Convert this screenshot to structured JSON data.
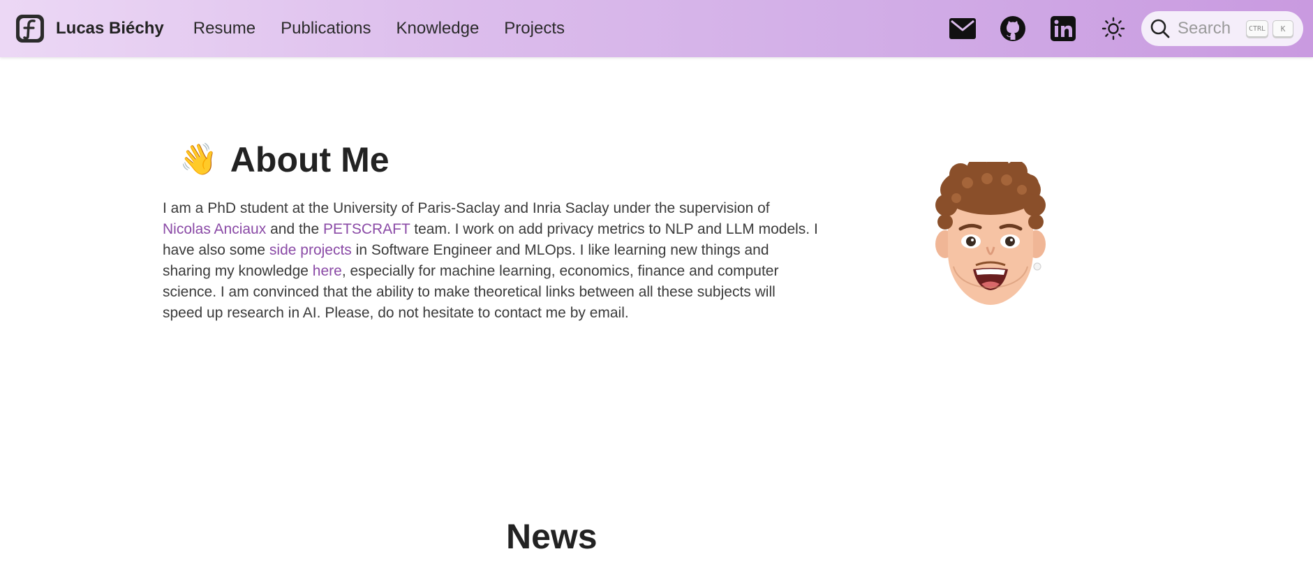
{
  "site": {
    "name": "Lucas Biéchy"
  },
  "nav": {
    "links": [
      "Resume",
      "Publications",
      "Knowledge",
      "Projects"
    ]
  },
  "icons": {
    "social": [
      "email-icon",
      "github-icon",
      "linkedin-icon"
    ],
    "theme": "sun-icon",
    "search": "search-icon"
  },
  "search": {
    "placeholder": "Search",
    "shortcut": [
      "CTRL",
      "K"
    ]
  },
  "about": {
    "emoji": "👋",
    "title": "About Me",
    "bio": {
      "t1": "I am a PhD student at the University of Paris-Saclay and Inria Saclay under the supervision of ",
      "link1": "Nicolas Anciaux",
      "t2": " and the ",
      "link2": "PETSCRAFT",
      "t3": " team. I work on add privacy metrics to NLP and LLM models. I have also some ",
      "link3": "side projects",
      "t4": " in Software Engineer and MLOps. I like learning new things and sharing my knowledge ",
      "link4": "here",
      "t5": ", especially for machine learning, economics, finance and computer science. I am convinced that the ability to make theoretical links between all these subjects will speed up research in AI. Please, do not hesitate to contact me by email."
    }
  },
  "news": {
    "title": "News"
  },
  "colors": {
    "link": "#8a4aa6",
    "nav_gradient_start": "#ecd8f5",
    "nav_gradient_end": "#c99ae0"
  }
}
